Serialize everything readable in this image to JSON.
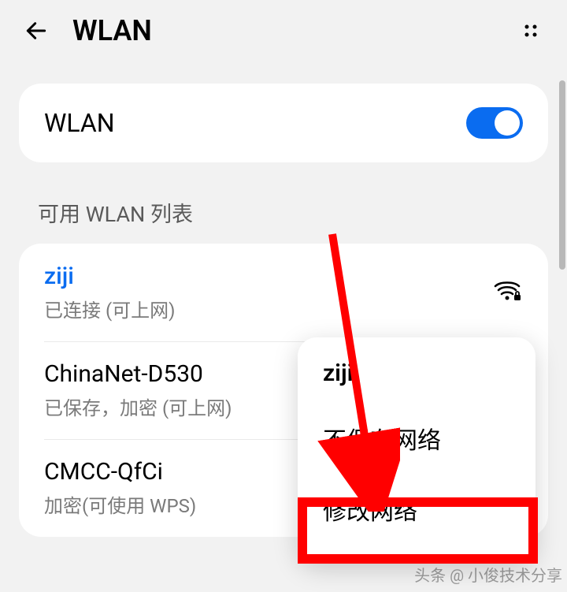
{
  "header": {
    "title": "WLAN"
  },
  "toggle": {
    "label": "WLAN",
    "on": true
  },
  "section": {
    "title": "可用 WLAN 列表"
  },
  "networks": [
    {
      "name": "ziji",
      "status": "已连接 (可上网)",
      "connected": true
    },
    {
      "name": "ChinaNet-D530",
      "status": "已保存，加密 (可上网)",
      "connected": false
    },
    {
      "name": "CMCC-QfCi",
      "status": "加密(可使用 WPS)",
      "connected": false
    }
  ],
  "contextMenu": {
    "title": "ziji",
    "items": [
      "不保存网络",
      "修改网络"
    ]
  },
  "footer": "头条 @ 小俊技术分享",
  "colors": {
    "accent": "#0a6cf0",
    "highlight": "#ff0000"
  }
}
